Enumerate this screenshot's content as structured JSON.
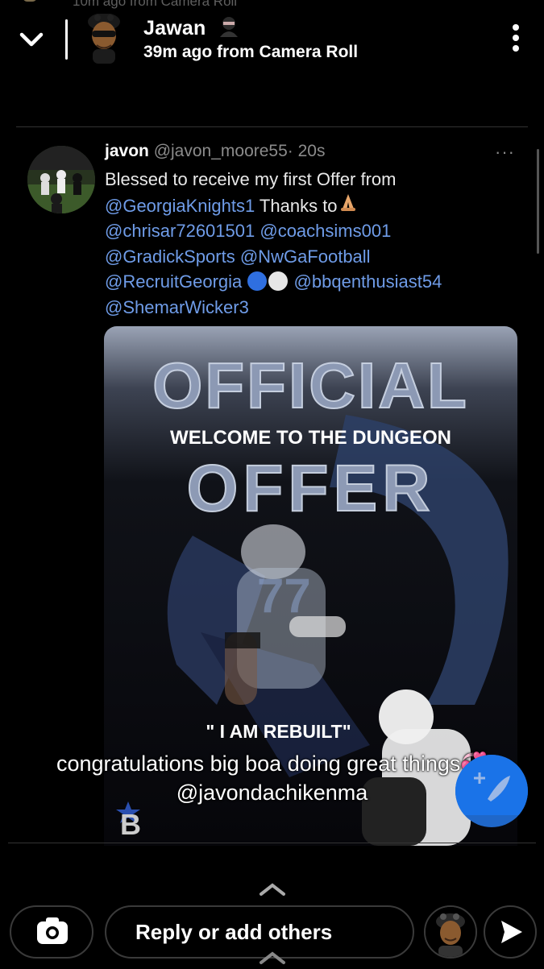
{
  "header": {
    "ghost_text": "10m ago from Camera Roll",
    "username": "Jawan",
    "subtitle": "39m ago from Camera Roll"
  },
  "tweet": {
    "display_name": "javon",
    "handle": "@javon_moore55",
    "time": "· 20s",
    "more": "···",
    "text_1": "Blessed to receive my first Offer from",
    "mention_1": "@GeorgiaKnights1",
    "text_2": " Thanks to",
    "mention_2": "@chrisar72601501",
    "mention_3": "@coachsims001",
    "mention_4": "@GradickSports",
    "mention_5": "@NwGaFootball",
    "mention_6": "@RecruitGeorgia",
    "mention_7": "@bbqenthusiast54",
    "mention_8": "@ShemarWicker3"
  },
  "media": {
    "headline": "OFFICIAL",
    "welcome": "WELCOME TO THE DUNGEON",
    "offer": "OFFER",
    "jersey": "77",
    "quote": "\" I AM REBUILT\"",
    "logo_letter": "B"
  },
  "caption": {
    "line_1": "congratulations big boa doing great things💞",
    "line_2": "@javondachikenma"
  },
  "composer": {
    "reply_placeholder": "Reply or add others"
  },
  "icons": {
    "back": "chevron-down-icon",
    "menu": "kebab-icon",
    "camera": "camera-icon",
    "send": "send-icon",
    "compose": "compose-icon"
  },
  "colors": {
    "background": "#000000",
    "mention": "#6f9ce8",
    "fab": "#1a73e8"
  }
}
